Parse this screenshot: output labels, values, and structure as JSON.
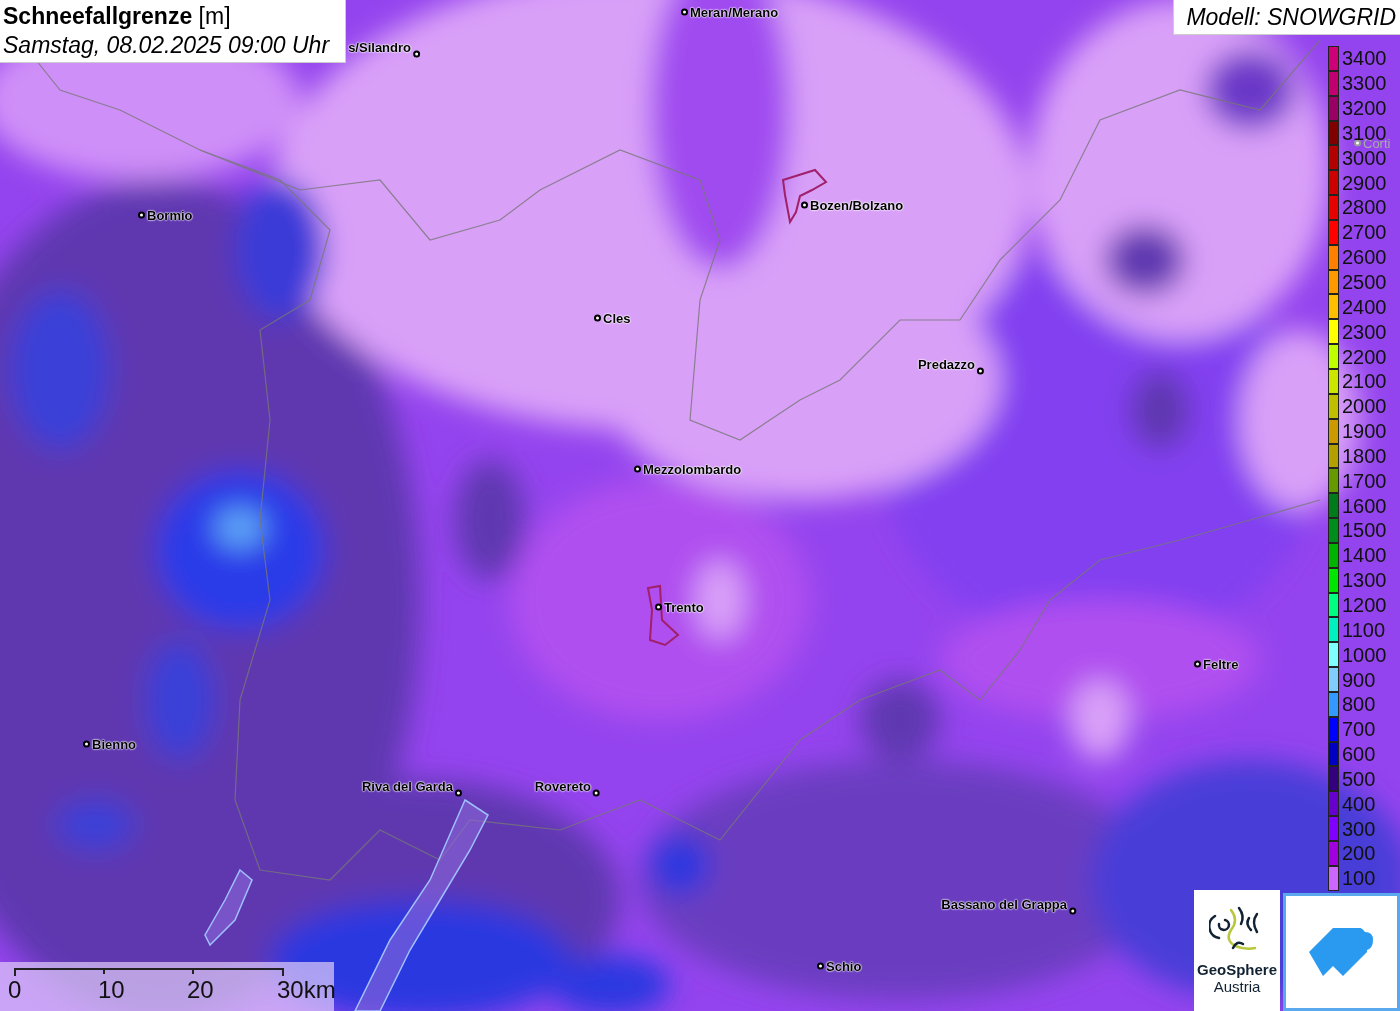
{
  "title": {
    "name": "Schneefallgrenze",
    "unit": "[m]",
    "time": "Samstag, 08.02.2025 09:00 Uhr"
  },
  "model": "Modell: SNOWGRID",
  "places": [
    {
      "name": "s/Silandro",
      "faded": false
    },
    {
      "name": "Meran/Merano",
      "faded": false
    },
    {
      "name": "Bormio",
      "faded": false
    },
    {
      "name": "Bozen/Bolzano",
      "faded": false
    },
    {
      "name": "Cles",
      "faded": false
    },
    {
      "name": "Predazzo",
      "faded": false
    },
    {
      "name": "Mezzolombardo",
      "faded": false
    },
    {
      "name": "Trento",
      "faded": false
    },
    {
      "name": "Feltre",
      "faded": false
    },
    {
      "name": "Bienno",
      "faded": false
    },
    {
      "name": "Riva del Garda",
      "faded": false
    },
    {
      "name": "Rovereto",
      "faded": false
    },
    {
      "name": "Bassano del Grappa",
      "faded": false
    },
    {
      "name": "Schio",
      "faded": false
    },
    {
      "name": "Corti",
      "faded": true
    }
  ],
  "legend": [
    {
      "label": "3400",
      "color": "#cc0077"
    },
    {
      "label": "3300",
      "color": "#c00070"
    },
    {
      "label": "3200",
      "color": "#990066"
    },
    {
      "label": "3100",
      "color": "#800000"
    },
    {
      "label": "3000",
      "color": "#b30000"
    },
    {
      "label": "2900",
      "color": "#cc0000"
    },
    {
      "label": "2800",
      "color": "#e60000"
    },
    {
      "label": "2700",
      "color": "#ff0000"
    },
    {
      "label": "2600",
      "color": "#ff8000"
    },
    {
      "label": "2500",
      "color": "#ff9900"
    },
    {
      "label": "2400",
      "color": "#ffbf00"
    },
    {
      "label": "2300",
      "color": "#ffff00"
    },
    {
      "label": "2200",
      "color": "#bfff00"
    },
    {
      "label": "2100",
      "color": "#cce600"
    },
    {
      "label": "2000",
      "color": "#bfbf00"
    },
    {
      "label": "1900",
      "color": "#cc9900"
    },
    {
      "label": "1800",
      "color": "#b3a000"
    },
    {
      "label": "1700",
      "color": "#669900"
    },
    {
      "label": "1600",
      "color": "#007a1a"
    },
    {
      "label": "1500",
      "color": "#008c1a"
    },
    {
      "label": "1400",
      "color": "#00b300"
    },
    {
      "label": "1300",
      "color": "#00e600"
    },
    {
      "label": "1200",
      "color": "#00ff80"
    },
    {
      "label": "1100",
      "color": "#00f0c0"
    },
    {
      "label": "1000",
      "color": "#80ffff"
    },
    {
      "label": "900",
      "color": "#80ccff"
    },
    {
      "label": "800",
      "color": "#3399ff"
    },
    {
      "label": "700",
      "color": "#0000ff"
    },
    {
      "label": "600",
      "color": "#0000c0"
    },
    {
      "label": "500",
      "color": "#330080"
    },
    {
      "label": "400",
      "color": "#6600cc"
    },
    {
      "label": "300",
      "color": "#8000ff"
    },
    {
      "label": "200",
      "color": "#a000e0"
    },
    {
      "label": "100",
      "color": "#cc66ff"
    }
  ],
  "scale": {
    "ticks": [
      "0",
      "10",
      "20",
      "30km"
    ]
  },
  "logos": {
    "name": "GeoSphere",
    "country": "Austria"
  }
}
